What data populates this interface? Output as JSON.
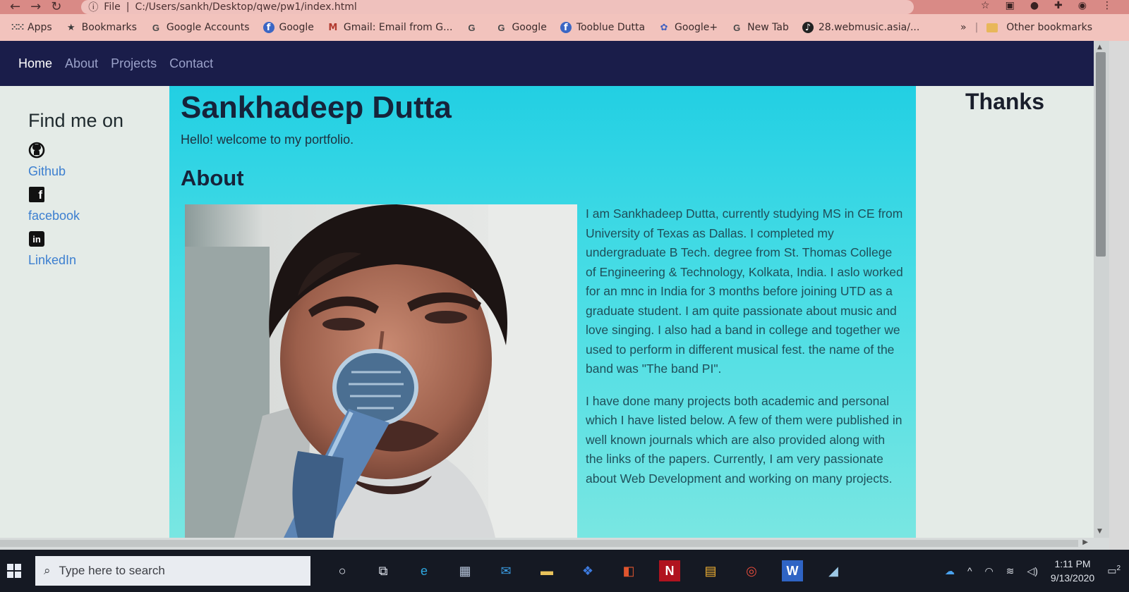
{
  "browser": {
    "url": "C:/Users/sankh/Desktop/qwe/pw1/index.html",
    "url_scheme_label": "File",
    "bookmarks": [
      {
        "label": "Apps",
        "icon": "apps-icon"
      },
      {
        "label": "Bookmarks",
        "icon": "star-icon"
      },
      {
        "label": "Google Accounts",
        "icon": "google-icon"
      },
      {
        "label": "Google",
        "icon": "facebook-icon"
      },
      {
        "label": "Gmail: Email from G...",
        "icon": "gmail-icon"
      },
      {
        "label": "",
        "icon": "google-icon"
      },
      {
        "label": "Google",
        "icon": "google-icon"
      },
      {
        "label": "Tooblue Dutta",
        "icon": "facebook-icon"
      },
      {
        "label": "Google+",
        "icon": "google-plus-icon"
      },
      {
        "label": "New Tab",
        "icon": "google-icon"
      },
      {
        "label": "28.webmusic.asia/...",
        "icon": "site-icon"
      }
    ],
    "more_label": "»",
    "other_bookmarks": "Other bookmarks"
  },
  "site": {
    "nav": [
      {
        "label": "Home",
        "active": true
      },
      {
        "label": "About",
        "active": false
      },
      {
        "label": "Projects",
        "active": false
      },
      {
        "label": "Contact",
        "active": false
      }
    ],
    "sidebar": {
      "heading": "Find me on",
      "links": [
        {
          "label": "Github",
          "icon": "github-icon"
        },
        {
          "label": "facebook",
          "icon": "facebook-icon"
        },
        {
          "label": "LinkedIn",
          "icon": "linkedin-icon"
        }
      ]
    },
    "main": {
      "name": "Sankhadeep Dutta",
      "welcome": "Hello! welcome to my portfolio.",
      "about_heading": "About",
      "paragraphs": [
        "I am Sankhadeep Dutta, currently studying MS in CE from University of Texas as Dallas. I completed my undergraduate B Tech. degree from St. Thomas College of Engineering & Technology, Kolkata, India. I aslo worked for an mnc in India for 3 months before joining UTD as a graduate student. I am quite passionate about music and love singing. I also had a band in college and together we used to perform in different musical fest. the name of the band was \"The band PI\".",
        "I have done many projects both academic and personal which I have listed below. A few of them were published in well known journals which are also provided along with the links of the papers. Currently, I am very passionate about Web Development and working on many projects."
      ]
    },
    "right": {
      "heading": "Thanks"
    },
    "colors": {
      "nav_bg": "#1a1d4a",
      "main_bg": "#22cfe3",
      "link": "#3c7fd0"
    }
  },
  "taskbar": {
    "search_placeholder": "Type here to search",
    "time": "1:11 PM",
    "date": "9/13/2020",
    "notification_count": "2"
  }
}
